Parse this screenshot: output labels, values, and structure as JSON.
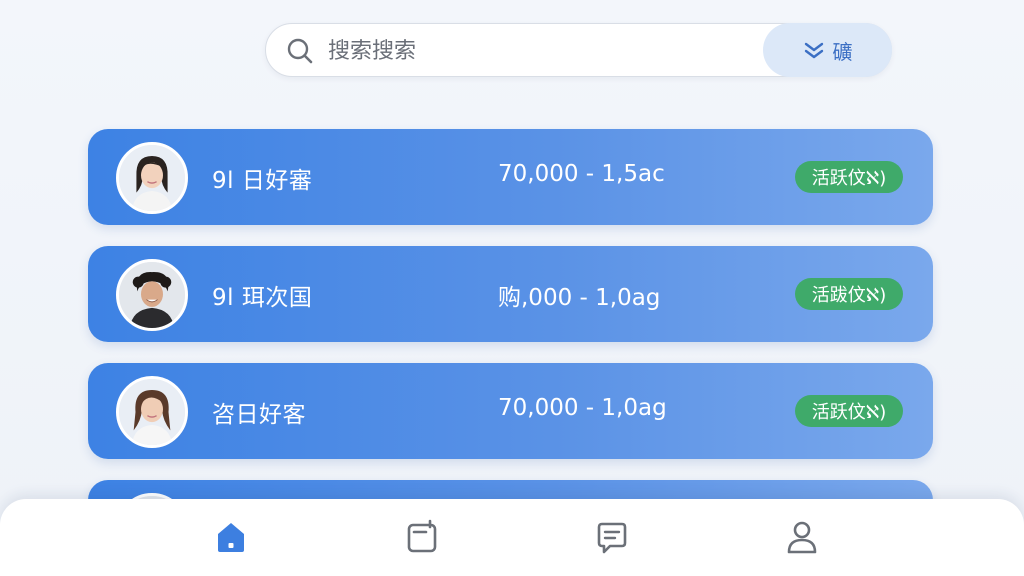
{
  "search": {
    "placeholder": "搜索搜索",
    "filter_label": "礦"
  },
  "records": [
    {
      "name": "9l 日好審",
      "range": "70,000 - 1,5ac",
      "status": "活跃伩ℵ)"
    },
    {
      "name": "9l 珥次国",
      "range": "购,000 - 1,0ag",
      "status": "活跋伩ℵ)"
    },
    {
      "name": "咨日好客",
      "range": "70,000 - 1,0ag",
      "status": "活跃伩ℵ)"
    }
  ],
  "colors": {
    "accent": "#3d82e4",
    "status_green": "#3faa6a",
    "nav_active": "#3d7fe0",
    "nav_inactive": "#6b7078"
  },
  "nav": {
    "items": [
      "home-icon",
      "notes-icon",
      "messages-icon",
      "profile-icon"
    ],
    "active": "home-icon"
  }
}
